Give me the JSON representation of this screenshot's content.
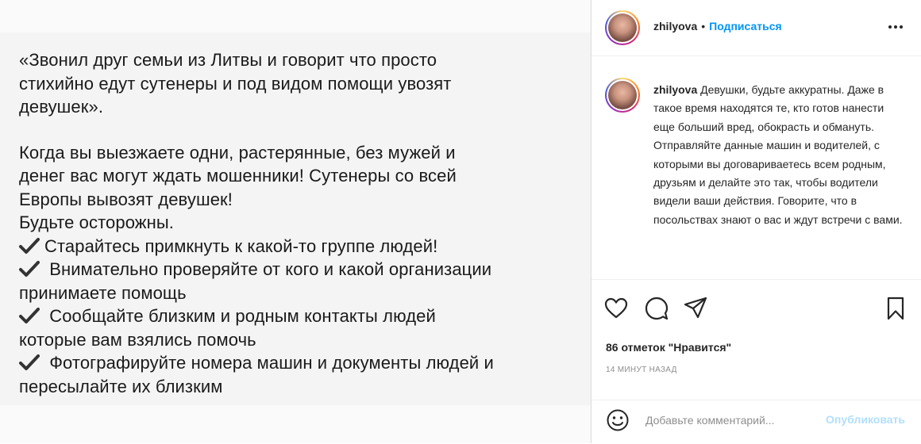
{
  "post": {
    "lines_top": [
      "«Звонил друг семьи из Литвы и говорит что просто",
      "стихийно едут сутенеры и под видом помощи увозят",
      "девушек»."
    ],
    "lines_mid": [
      "Когда вы выезжаете одни, растерянные, без мужей и",
      "денег вас могут ждать мошенники! Сутенеры со всей",
      "Европы вывозят девушек!",
      "Будьте осторожны."
    ],
    "checklist": [
      {
        "first": "Старайтесь примкнуть к какой-то группе людей!",
        "second": ""
      },
      {
        "first": "Внимательно проверяйте от кого и какой организации",
        "second": "принимаете помощь"
      },
      {
        "first": "Сообщайте близким и родным контакты людей",
        "second": "которые вам взялись помочь"
      },
      {
        "first": "Фотографируйте номера машин и документы людей и",
        "second": "пересылайте их близким"
      }
    ]
  },
  "header": {
    "username": "zhilyova",
    "separator": "•",
    "follow_label": "Подписаться",
    "more_icon": "more-horizontal-icon"
  },
  "caption": {
    "username": "zhilyova",
    "text": "Девушки, будьте аккуратны. Даже в такое время находятся те, кто готов нанести еще больший вред, обокрасть и обмануть. Отправляйте данные машин и водителей, с которыми вы договариваетесь всем родным, друзьям и делайте это так, чтобы водители видели ваши действия. Говорите, что в посольствах знают о вас и ждут встречи с вами."
  },
  "actions": {
    "icons": [
      "heart-icon",
      "comment-icon",
      "share-icon",
      "bookmark-icon"
    ],
    "likes": "86 отметок \"Нравится\"",
    "timestamp": "14 МИНУТ НАЗАД"
  },
  "comment": {
    "placeholder": "Добавьте комментарий...",
    "publish_label": "Опубликовать"
  },
  "colors": {
    "accent": "#0095f6",
    "publish_disabled": "#b2dffc",
    "muted": "#8e8e8e",
    "text": "#262626"
  }
}
